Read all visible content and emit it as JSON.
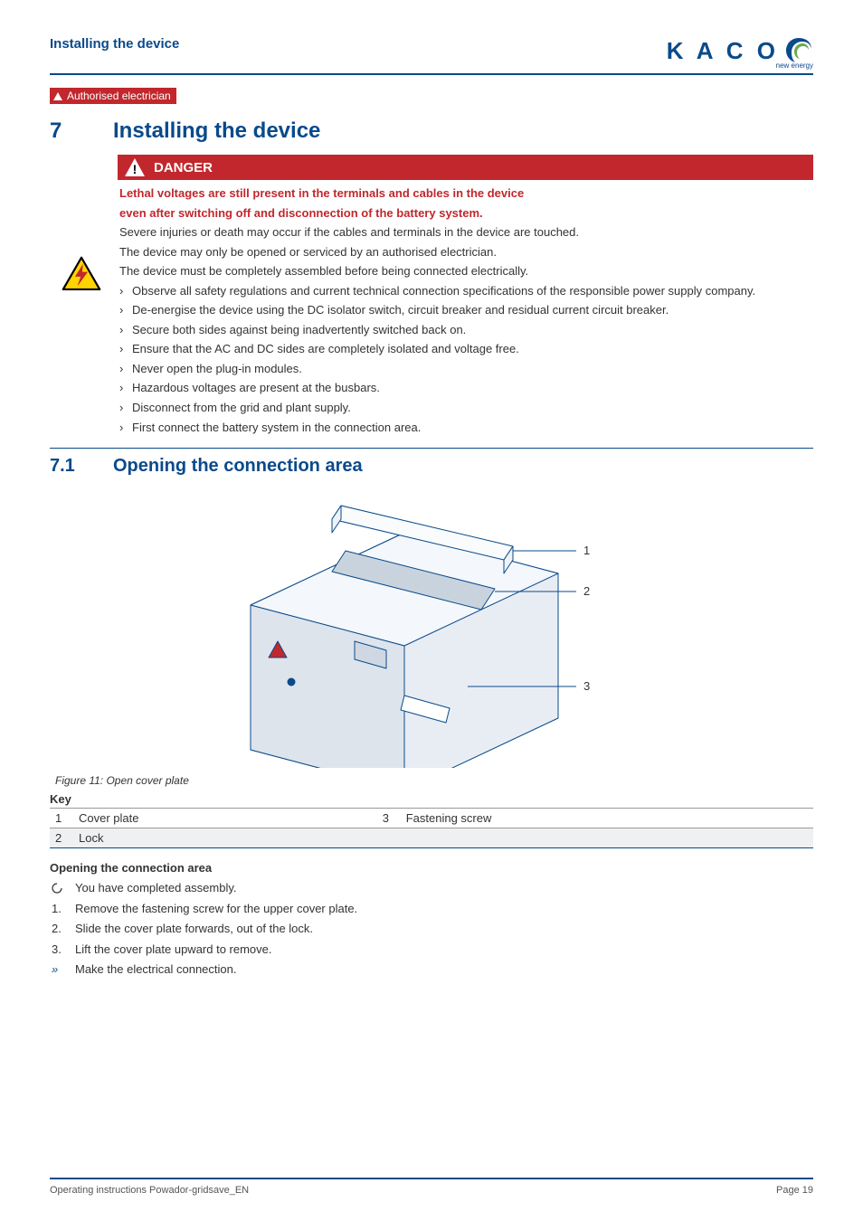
{
  "header": {
    "title": "Installing the device"
  },
  "logo": {
    "text": "K A C O",
    "sub": "new energy"
  },
  "auth_badge": "Authorised electrician",
  "section": {
    "num": "7",
    "title": "Installing the device"
  },
  "danger": {
    "label": "DANGER",
    "head1": "Lethal voltages are still present in the terminals and cables in the device",
    "head2": "even after switching off and disconnection of the battery system.",
    "p1": "Severe injuries or death may occur if the cables and terminals in the device are touched.",
    "p2": "The device may only be opened or serviced by an authorised electrician.",
    "p3": "The device must be completely assembled before being connected electrically.",
    "bullets": [
      "Observe all safety regulations and current technical connection specifications of the responsible power supply company.",
      "De-energise the device using the DC isolator switch, circuit breaker and residual current circuit breaker.",
      "Secure both sides against being inadvertently switched back on.",
      "Ensure that the AC and DC sides are completely isolated and voltage free.",
      "Never open the plug-in modules.",
      "Hazardous voltages are present at the busbars.",
      "Disconnect from the grid and plant supply.",
      "First connect the battery system in the connection area."
    ]
  },
  "subsection": {
    "num": "7.1",
    "title": "Opening the connection area"
  },
  "figure": {
    "caption": "Figure 11:  Open cover plate",
    "callouts": {
      "c1": "1",
      "c2": "2",
      "c3": "3"
    }
  },
  "key": {
    "head": "Key",
    "rows": [
      {
        "n1": "1",
        "t1": "Cover plate",
        "n2": "3",
        "t2": "Fastening screw"
      },
      {
        "n1": "2",
        "t1": "Lock",
        "n2": "",
        "t2": ""
      }
    ]
  },
  "procedure": {
    "head": "Opening the connection area",
    "items": [
      {
        "mark_type": "pre",
        "text": "You have completed assembly."
      },
      {
        "mark_type": "num",
        "mark": "1.",
        "text": "Remove the fastening screw for the upper cover plate."
      },
      {
        "mark_type": "num",
        "mark": "2.",
        "text": "Slide the cover plate forwards, out of the lock."
      },
      {
        "mark_type": "num",
        "mark": "3.",
        "text": "Lift the cover plate upward to remove."
      },
      {
        "mark_type": "end",
        "mark": "»",
        "text": "Make the electrical connection."
      }
    ]
  },
  "footer": {
    "left": "Operating instructions Powador-gridsave_EN",
    "right": "Page 19"
  }
}
